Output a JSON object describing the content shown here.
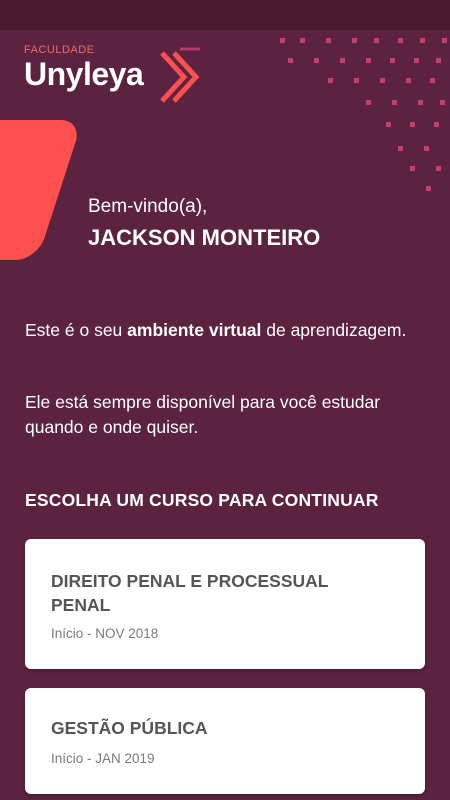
{
  "brand": {
    "small_label": "FACULDADE",
    "name": "Unyleya",
    "accent": "#ff4f4f",
    "background": "#5c2340"
  },
  "welcome": {
    "greeting": "Bem-vindo(a),",
    "user_name": "JACKSON MONTEIRO"
  },
  "intro": {
    "line1_prefix": "Este é o seu ",
    "line1_bold": "ambiente virtual",
    "line1_suffix": " de aprendizagem.",
    "line2": "Ele está sempre disponível para você estudar quando e onde quiser."
  },
  "courses": {
    "heading": "ESCOLHA UM CURSO PARA CONTINUAR",
    "items": [
      {
        "title": "DIREITO PENAL E PROCESSUAL PENAL",
        "start": "Início - NOV 2018"
      },
      {
        "title": "GESTÃO PÚBLICA",
        "start": "Início - JAN 2019"
      }
    ]
  }
}
